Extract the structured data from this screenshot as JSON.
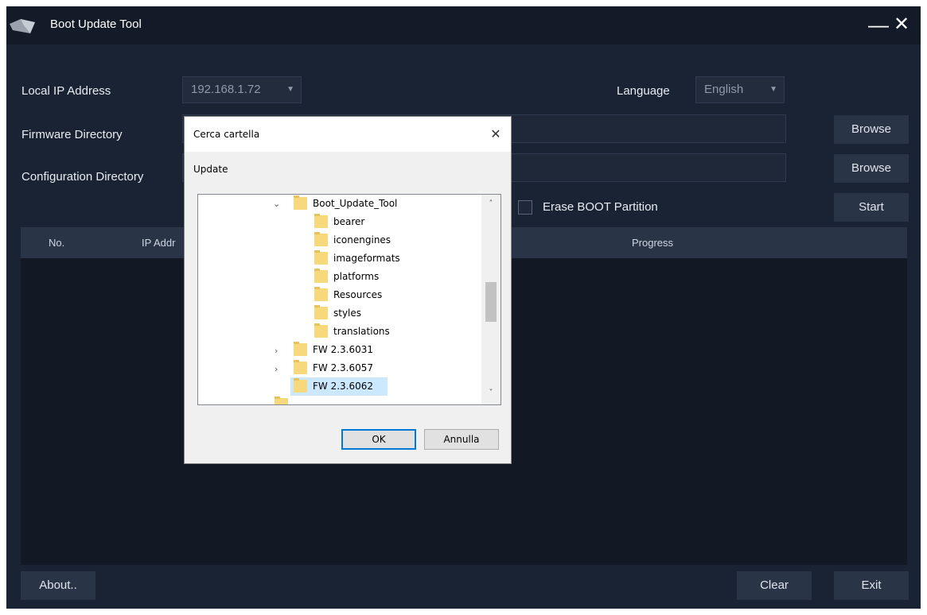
{
  "window": {
    "title": "Boot Update Tool",
    "minimize_glyph": "—",
    "close_glyph": "✕"
  },
  "form": {
    "local_ip_label": "Local IP Address",
    "local_ip_value": "192.168.1.72",
    "language_label": "Language",
    "language_value": "English",
    "firmware_dir_label": "Firmware Directory",
    "config_dir_label": "Configuration Directory",
    "browse_label": "Browse",
    "erase_boot_label": "Erase BOOT Partition",
    "start_label": "Start"
  },
  "table": {
    "columns": [
      "No.",
      "IP Addr",
      "Progress"
    ]
  },
  "footer": {
    "about_label": "About..",
    "clear_label": "Clear",
    "exit_label": "Exit"
  },
  "dialog": {
    "title": "Cerca cartella",
    "description": "Update",
    "tree": [
      {
        "name": "Boot_Update_Tool",
        "expander": "⌄",
        "selected": false
      },
      {
        "name": "bearer",
        "expander": "",
        "selected": false
      },
      {
        "name": "iconengines",
        "expander": "",
        "selected": false
      },
      {
        "name": "imageformats",
        "expander": "",
        "selected": false
      },
      {
        "name": "platforms",
        "expander": "",
        "selected": false
      },
      {
        "name": "Resources",
        "expander": "",
        "selected": false
      },
      {
        "name": "styles",
        "expander": "",
        "selected": false
      },
      {
        "name": "translations",
        "expander": "",
        "selected": false
      },
      {
        "name": "FW 2.3.6031",
        "expander": "›",
        "selected": false
      },
      {
        "name": "FW 2.3.6057",
        "expander": "›",
        "selected": false
      },
      {
        "name": "FW 2.3.6062",
        "expander": "",
        "selected": true
      }
    ],
    "ok_label": "OK",
    "cancel_label": "Annulla"
  },
  "icons": {
    "app_logo": "app-logo-icon",
    "dropdown": "chevron-down-icon",
    "folder": "folder-icon",
    "expand": "chevron-right-icon",
    "collapse": "chevron-down-icon"
  },
  "colors": {
    "app_background": "#1a2333",
    "titlebar": "#131b28",
    "button": "#2a3447",
    "dialog_selected": "#cce8ff",
    "dialog_primary_border": "#0078d7"
  }
}
